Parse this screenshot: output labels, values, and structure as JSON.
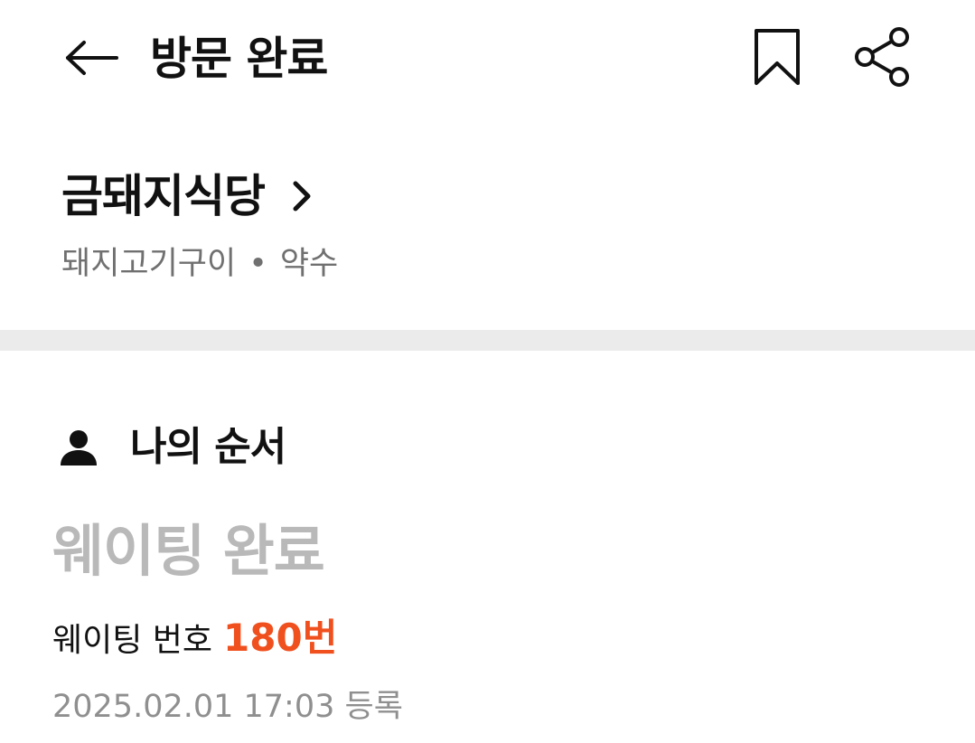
{
  "header": {
    "title": "방문 완료",
    "back_icon": "arrow-left-icon",
    "bookmark_icon": "bookmark-icon",
    "share_icon": "share-icon"
  },
  "store": {
    "name": "금돼지식당",
    "category": "돼지고기구이",
    "separator": "•",
    "location": "약수"
  },
  "my_order": {
    "section_title": "나의 순서",
    "section_icon": "person-icon",
    "status": "웨이팅 완료",
    "number_label": "웨이팅 번호",
    "number_value": "180번",
    "registered_at": "2025.02.01 17:03 등록"
  },
  "colors": {
    "accent": "#f0501e",
    "status_muted": "#b9b9b9",
    "meta_text": "#707070",
    "divider": "#ebebeb"
  }
}
